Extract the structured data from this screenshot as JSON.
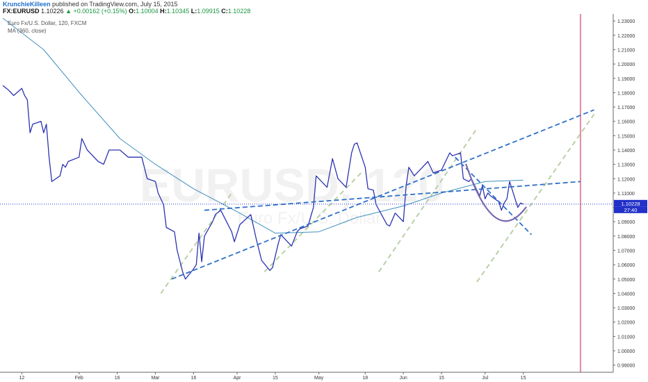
{
  "header": {
    "author": "KrunchieKilleen",
    "published": "published on TradingView.com, July 15, 2015",
    "symbol": "FX:EURUSD",
    "last": "1.10226",
    "change_arrow": "▲",
    "change": "+0.00162 (+0.15%)",
    "o_label": "O:",
    "o_value": "1.10004",
    "h_label": "H:",
    "h_value": "1.10345",
    "l_label": "L:",
    "l_value": "1.09915",
    "c_label": "C:",
    "c_value": "1.10228"
  },
  "legend": {
    "instrument": "Euro Fx/U.S. Dollar, 120, FXCM",
    "indicator": "MA (360, close)"
  },
  "watermark": {
    "symbol": "EURUSD, 120",
    "description": "Euro Fx/U.S. Dollar"
  },
  "price_tag": "1.10228",
  "countdown_tag": "27:40",
  "colors": {
    "price": "#2b32b2",
    "ma": "#3f8fbd",
    "channel": "#2f6fc8",
    "guide": "#b9d0a6",
    "arc": "#7a6ab0",
    "marker": "#e08aa2",
    "tag": "#2230c8"
  },
  "chart_data": {
    "type": "line",
    "title": "Euro Fx/U.S. Dollar, 120, FXCM",
    "xlabel": "",
    "ylabel": "",
    "x_tick_labels": [
      "12",
      "Feb",
      "16",
      "Mar",
      "16",
      "Apr",
      "15",
      "May",
      "18",
      "Jun",
      "15",
      "Jul",
      "15"
    ],
    "y_tick_labels": [
      "1.23000",
      "1.22000",
      "1.21000",
      "1.20000",
      "1.19000",
      "1.18000",
      "1.17000",
      "1.16000",
      "1.15000",
      "1.14000",
      "1.13000",
      "1.12000",
      "1.11000",
      "1.10000",
      "1.09000",
      "1.08000",
      "1.07000",
      "1.06000",
      "1.05000",
      "1.04000",
      "1.03000",
      "1.02000",
      "1.01000",
      "1.00000",
      "0.99000"
    ],
    "ylim": [
      0.985,
      1.233
    ],
    "grid": false,
    "series": [
      {
        "name": "Euro Fx/U.S. Dollar",
        "points": [
          [
            "2015-01-05",
            1.185
          ],
          [
            "2015-01-07",
            1.182
          ],
          [
            "2015-01-09",
            1.178
          ],
          [
            "2015-01-12",
            1.183
          ],
          [
            "2015-01-13",
            1.178
          ],
          [
            "2015-01-14",
            1.175
          ],
          [
            "2015-01-15",
            1.152
          ],
          [
            "2015-01-16",
            1.158
          ],
          [
            "2015-01-19",
            1.16
          ],
          [
            "2015-01-20",
            1.152
          ],
          [
            "2015-01-21",
            1.158
          ],
          [
            "2015-01-22",
            1.135
          ],
          [
            "2015-01-23",
            1.118
          ],
          [
            "2015-01-26",
            1.122
          ],
          [
            "2015-01-27",
            1.13
          ],
          [
            "2015-01-28",
            1.128
          ],
          [
            "2015-01-29",
            1.132
          ],
          [
            "2015-02-02",
            1.135
          ],
          [
            "2015-02-03",
            1.148
          ],
          [
            "2015-02-05",
            1.14
          ],
          [
            "2015-02-09",
            1.132
          ],
          [
            "2015-02-11",
            1.13
          ],
          [
            "2015-02-13",
            1.14
          ],
          [
            "2015-02-17",
            1.14
          ],
          [
            "2015-02-20",
            1.135
          ],
          [
            "2015-02-23",
            1.135
          ],
          [
            "2015-02-25",
            1.135
          ],
          [
            "2015-02-27",
            1.12
          ],
          [
            "2015-03-02",
            1.118
          ],
          [
            "2015-03-03",
            1.11
          ],
          [
            "2015-03-05",
            1.102
          ],
          [
            "2015-03-06",
            1.086
          ],
          [
            "2015-03-09",
            1.083
          ],
          [
            "2015-03-10",
            1.07
          ],
          [
            "2015-03-12",
            1.055
          ],
          [
            "2015-03-13",
            1.05
          ],
          [
            "2015-03-16",
            1.057
          ],
          [
            "2015-03-17",
            1.06
          ],
          [
            "2015-03-18",
            1.082
          ],
          [
            "2015-03-19",
            1.062
          ],
          [
            "2015-03-20",
            1.08
          ],
          [
            "2015-03-23",
            1.09
          ],
          [
            "2015-03-24",
            1.095
          ],
          [
            "2015-03-26",
            1.098
          ],
          [
            "2015-03-30",
            1.083
          ],
          [
            "2015-03-31",
            1.076
          ],
          [
            "2015-04-02",
            1.088
          ],
          [
            "2015-04-06",
            1.095
          ],
          [
            "2015-04-08",
            1.078
          ],
          [
            "2015-04-10",
            1.063
          ],
          [
            "2015-04-13",
            1.056
          ],
          [
            "2015-04-14",
            1.058
          ],
          [
            "2015-04-16",
            1.074
          ],
          [
            "2015-04-17",
            1.081
          ],
          [
            "2015-04-21",
            1.073
          ],
          [
            "2015-04-23",
            1.083
          ],
          [
            "2015-04-24",
            1.085
          ],
          [
            "2015-04-27",
            1.087
          ],
          [
            "2015-04-29",
            1.1
          ],
          [
            "2015-04-30",
            1.122
          ],
          [
            "2015-05-01",
            1.12
          ],
          [
            "2015-05-04",
            1.114
          ],
          [
            "2015-05-06",
            1.134
          ],
          [
            "2015-05-08",
            1.12
          ],
          [
            "2015-05-11",
            1.114
          ],
          [
            "2015-05-13",
            1.138
          ],
          [
            "2015-05-14",
            1.144
          ],
          [
            "2015-05-15",
            1.145
          ],
          [
            "2015-05-18",
            1.128
          ],
          [
            "2015-05-19",
            1.113
          ],
          [
            "2015-05-21",
            1.112
          ],
          [
            "2015-05-22",
            1.102
          ],
          [
            "2015-05-26",
            1.088
          ],
          [
            "2015-05-27",
            1.087
          ],
          [
            "2015-05-29",
            1.096
          ],
          [
            "2015-06-01",
            1.09
          ],
          [
            "2015-06-02",
            1.115
          ],
          [
            "2015-06-03",
            1.128
          ],
          [
            "2015-06-05",
            1.122
          ],
          [
            "2015-06-08",
            1.128
          ],
          [
            "2015-06-10",
            1.132
          ],
          [
            "2015-06-12",
            1.124
          ],
          [
            "2015-06-15",
            1.126
          ],
          [
            "2015-06-16",
            1.13
          ],
          [
            "2015-06-18",
            1.138
          ],
          [
            "2015-06-19",
            1.136
          ],
          [
            "2015-06-22",
            1.138
          ],
          [
            "2015-06-23",
            1.12
          ],
          [
            "2015-06-25",
            1.118
          ],
          [
            "2015-06-26",
            1.12
          ],
          [
            "2015-06-29",
            1.108
          ],
          [
            "2015-06-30",
            1.115
          ],
          [
            "2015-07-01",
            1.106
          ],
          [
            "2015-07-02",
            1.11
          ],
          [
            "2015-07-03",
            1.108
          ],
          [
            "2015-07-06",
            1.104
          ],
          [
            "2015-07-07",
            1.098
          ],
          [
            "2015-07-08",
            1.103
          ],
          [
            "2015-07-09",
            1.106
          ],
          [
            "2015-07-10",
            1.118
          ],
          [
            "2015-07-13",
            1.1
          ],
          [
            "2015-07-14",
            1.103
          ],
          [
            "2015-07-15",
            1.1023
          ]
        ]
      },
      {
        "name": "MA (360, close)",
        "points": [
          [
            "2015-01-05",
            1.232
          ],
          [
            "2015-01-20",
            1.21
          ],
          [
            "2015-02-03",
            1.178
          ],
          [
            "2015-02-17",
            1.148
          ],
          [
            "2015-03-02",
            1.13
          ],
          [
            "2015-03-16",
            1.113
          ],
          [
            "2015-04-01",
            1.097
          ],
          [
            "2015-04-15",
            1.082
          ],
          [
            "2015-05-01",
            1.083
          ],
          [
            "2015-05-15",
            1.093
          ],
          [
            "2015-06-01",
            1.101
          ],
          [
            "2015-06-15",
            1.11
          ],
          [
            "2015-07-01",
            1.118
          ],
          [
            "2015-07-15",
            1.119
          ]
        ]
      }
    ],
    "annotations": [
      {
        "type": "trendline",
        "style": "dashed",
        "from": [
          "2015-03-08",
          1.05
        ],
        "to": [
          "2015-08-10",
          1.168
        ]
      },
      {
        "type": "trendline",
        "style": "dashed",
        "from": [
          "2015-03-20",
          1.098
        ],
        "to": [
          "2015-08-05",
          1.118
        ]
      },
      {
        "type": "trendline",
        "style": "dashed",
        "from": [
          "2015-06-20",
          1.135
        ],
        "to": [
          "2015-07-18",
          1.081
        ]
      },
      {
        "type": "trendline",
        "style": "dashed-light",
        "from": [
          "2015-03-04",
          1.04
        ],
        "to": [
          "2015-03-30",
          1.11
        ]
      },
      {
        "type": "trendline",
        "style": "dashed-light",
        "from": [
          "2015-04-11",
          1.055
        ],
        "to": [
          "2015-05-17",
          1.125
        ]
      },
      {
        "type": "trendline",
        "style": "dashed-light",
        "from": [
          "2015-05-23",
          1.055
        ],
        "to": [
          "2015-06-28",
          1.155
        ]
      },
      {
        "type": "trendline",
        "style": "dashed-light",
        "from": [
          "2015-06-28",
          1.048
        ],
        "to": [
          "2015-08-10",
          1.165
        ]
      },
      {
        "type": "arc",
        "from": [
          "2015-06-24",
          1.13
        ],
        "to": [
          "2015-07-16",
          1.1
        ],
        "bottom": 1.093
      },
      {
        "type": "horizontal-line",
        "style": "dotted",
        "value": 1.1023
      },
      {
        "type": "vertical-line",
        "value": "2015-08-05"
      }
    ]
  }
}
